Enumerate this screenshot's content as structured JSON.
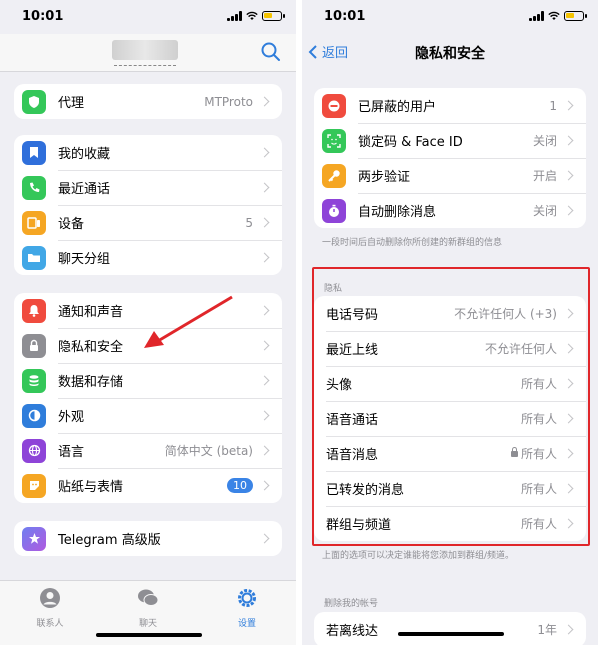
{
  "left": {
    "status_time": "10:01",
    "proxy": {
      "label": "代理",
      "value": "MTProto"
    },
    "group1": [
      {
        "label": "我的收藏",
        "icon": "bookmark-icon",
        "color": "#2f6fdb"
      },
      {
        "label": "最近通话",
        "icon": "phone-icon",
        "color": "#34c759"
      },
      {
        "label": "设备",
        "icon": "devices-icon",
        "color": "#f5a623",
        "value": "5"
      },
      {
        "label": "聊天分组",
        "icon": "folder-icon",
        "color": "#41a7e6"
      }
    ],
    "group2": [
      {
        "label": "通知和声音",
        "icon": "bell-icon",
        "color": "#f04b3e"
      },
      {
        "label": "隐私和安全",
        "icon": "lock-icon",
        "color": "#8e8e93"
      },
      {
        "label": "数据和存储",
        "icon": "database-icon",
        "color": "#34c759"
      },
      {
        "label": "外观",
        "icon": "appearance-icon",
        "color": "#2f7ddb"
      },
      {
        "label": "语言",
        "icon": "globe-icon",
        "color": "#8e44d8",
        "value": "简体中文 (beta)"
      },
      {
        "label": "贴纸与表情",
        "icon": "sticker-icon",
        "color": "#f5a623",
        "badge": "10"
      }
    ],
    "premium": {
      "label": "Telegram 高级版"
    },
    "tabs": [
      {
        "label": "联系人",
        "icon": "contacts-icon"
      },
      {
        "label": "聊天",
        "icon": "chats-icon"
      },
      {
        "label": "设置",
        "icon": "settings-icon"
      }
    ]
  },
  "right": {
    "status_time": "10:01",
    "back_label": "返回",
    "title": "隐私和安全",
    "security": [
      {
        "label": "已屏蔽的用户",
        "icon": "blocked-icon",
        "color": "#f04b3e",
        "value": "1"
      },
      {
        "label": "锁定码 & Face ID",
        "icon": "faceid-icon",
        "color": "#34c759",
        "value": "关闭"
      },
      {
        "label": "两步验证",
        "icon": "key-icon",
        "color": "#f5a623",
        "value": "开启"
      },
      {
        "label": "自动删除消息",
        "icon": "timer-icon",
        "color": "#8e44d8",
        "value": "关闭"
      }
    ],
    "security_note": "一段时间后自动删除你所创建的新群组的信息",
    "privacy_header": "隐私",
    "privacy": [
      {
        "label": "电话号码",
        "value": "不允许任何人 (+3)"
      },
      {
        "label": "最近上线",
        "value": "不允许任何人"
      },
      {
        "label": "头像",
        "value": "所有人"
      },
      {
        "label": "语音通话",
        "value": "所有人"
      },
      {
        "label": "语音消息",
        "value": "所有人",
        "locked": true
      },
      {
        "label": "已转发的消息",
        "value": "所有人"
      },
      {
        "label": "群组与频道",
        "value": "所有人"
      }
    ],
    "privacy_note": "上面的选项可以决定谁能将您添加到群组/频道。",
    "delete_header": "删除我的帐号",
    "delete_row": {
      "label": "若离线达",
      "value": "1年"
    }
  }
}
